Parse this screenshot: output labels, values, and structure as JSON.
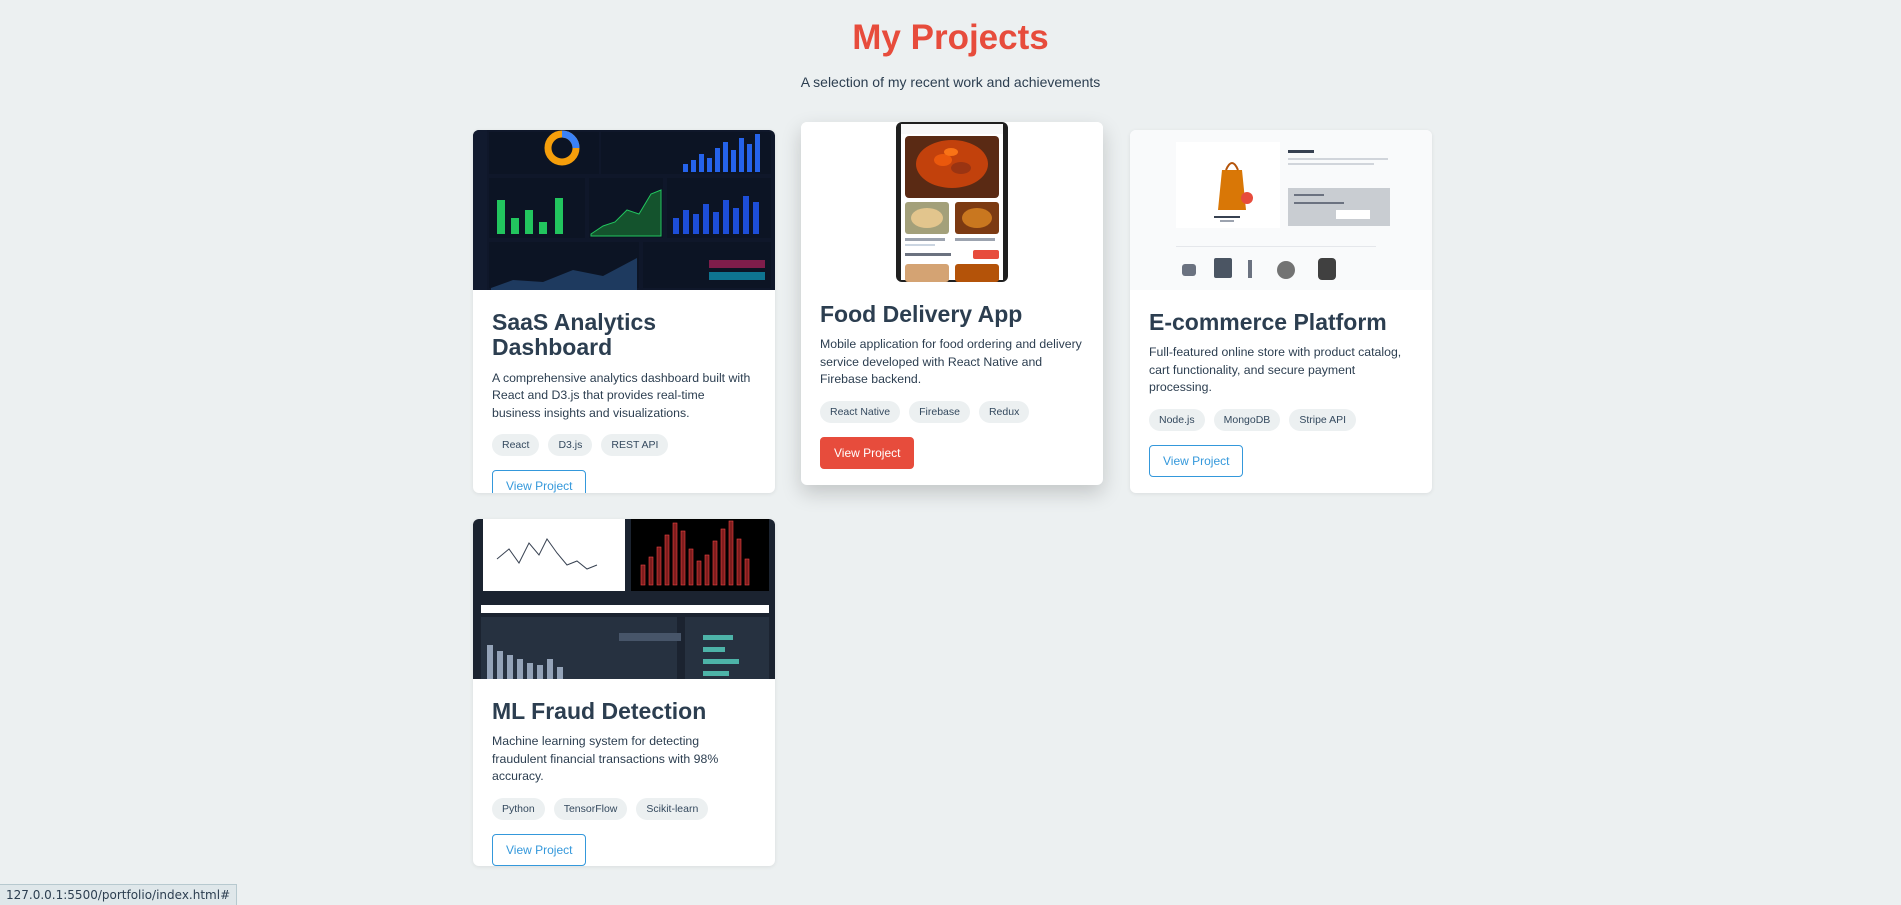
{
  "header": {
    "title": "My Projects",
    "subtitle": "A selection of my recent work and achievements"
  },
  "colors": {
    "accent": "#e74c3c",
    "link": "#3498db",
    "text": "#2c3e50",
    "background": "#ecf0f1"
  },
  "projects": [
    {
      "title": "SaaS Analytics Dashboard",
      "description": "A comprehensive analytics dashboard built with React and D3.js that provides real-time business insights and visualizations.",
      "tags": [
        "React",
        "D3.js",
        "REST API"
      ],
      "button": "View Project"
    },
    {
      "title": "Food Delivery App",
      "description": "Mobile application for food ordering and delivery service developed with React Native and Firebase backend.",
      "tags": [
        "React Native",
        "Firebase",
        "Redux"
      ],
      "button": "View Project"
    },
    {
      "title": "E-commerce Platform",
      "description": "Full-featured online store with product catalog, cart functionality, and secure payment processing.",
      "tags": [
        "Node.js",
        "MongoDB",
        "Stripe API"
      ],
      "button": "View Project"
    },
    {
      "title": "ML Fraud Detection",
      "description": "Machine learning system for detecting fraudulent financial transactions with 98% accuracy.",
      "tags": [
        "Python",
        "TensorFlow",
        "Scikit-learn"
      ],
      "button": "View Project"
    }
  ],
  "status_url": "127.0.0.1:5500/portfolio/index.html#"
}
